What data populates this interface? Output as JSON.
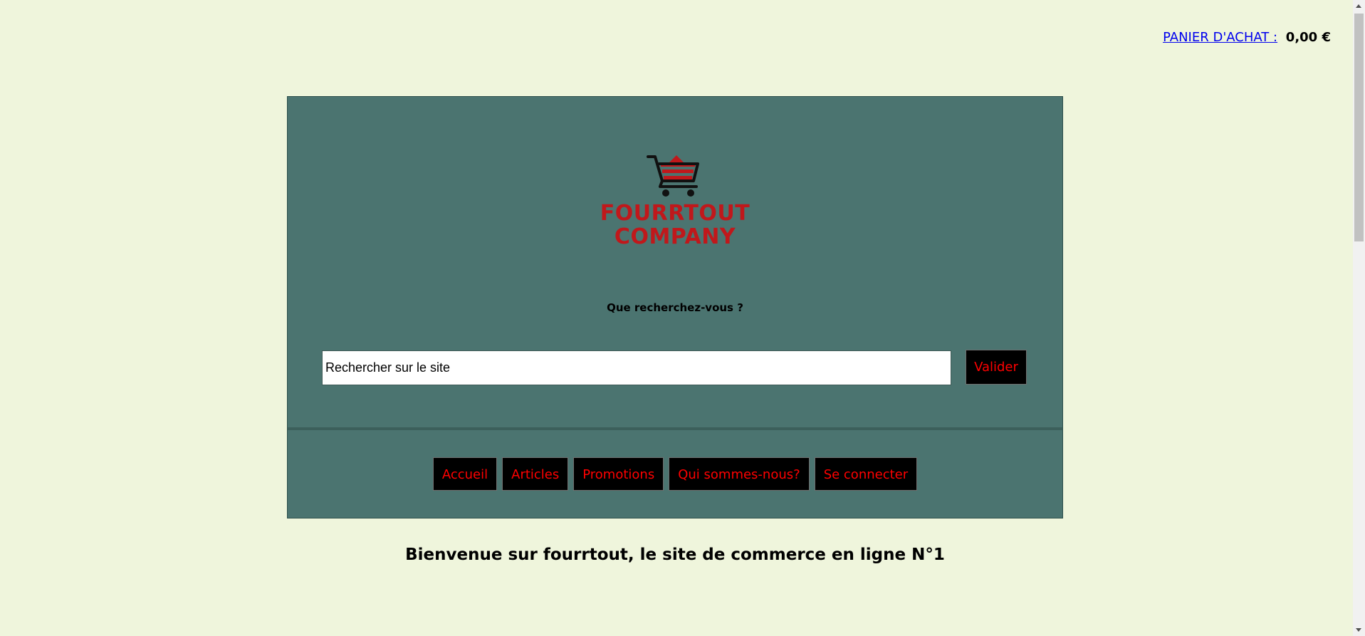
{
  "cart": {
    "link_label": "PANIER D'ACHAT :",
    "total": "0,00 €"
  },
  "logo": {
    "line1": "FOURRTOUT",
    "line2": "COMPANY",
    "icon": "shopping-cart-icon",
    "brand_color": "#c0181b"
  },
  "search": {
    "question": "Que recherchez-vous ?",
    "placeholder": "Rechercher sur le site",
    "value": "",
    "submit_label": "Valider"
  },
  "nav": {
    "items": [
      {
        "label": "Accueil"
      },
      {
        "label": "Articles"
      },
      {
        "label": "Promotions"
      },
      {
        "label": "Qui sommes-nous?"
      },
      {
        "label": "Se connecter"
      }
    ]
  },
  "main": {
    "welcome": "Bienvenue sur fourrtout, le site de commerce en ligne N°1"
  },
  "colors": {
    "page_background": "#eff5dc",
    "panel_background": "#4b7470",
    "button_background": "#000000",
    "button_text": "#ff0000",
    "link": "#0000ee"
  }
}
